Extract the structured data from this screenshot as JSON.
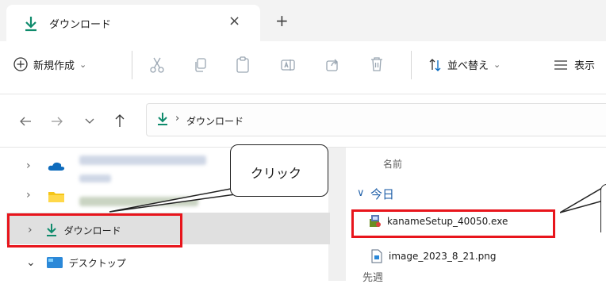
{
  "tab": {
    "title": "ダウンロード",
    "close_glyph": "×",
    "new_tab_glyph": "+"
  },
  "toolbar": {
    "new_label": "新規作成",
    "new_chevron": "⌄",
    "sort_label": "並べ替え",
    "sort_chevron": "⌄",
    "view_label": "表示"
  },
  "address": {
    "separator": "›",
    "path": "ダウンロード"
  },
  "sidebar": {
    "items": [
      {
        "expander": "›",
        "icon": "cloud-icon"
      },
      {
        "expander": "›",
        "icon": "folder-icon"
      },
      {
        "expander": "›",
        "label": "ダウンロード",
        "icon": "download-icon"
      },
      {
        "expander": "⌄",
        "label": "デスクトップ",
        "icon": "desktop-icon"
      }
    ]
  },
  "content": {
    "column_name": "名前",
    "group_today": "今日",
    "group_chevron": "∨",
    "files": [
      {
        "name": "kanameSetup_40050.exe",
        "icon": "installer-icon"
      },
      {
        "name": "image_2023_8_21.png",
        "icon": "image-file-icon"
      }
    ],
    "next_group_partial": "先週"
  },
  "callout": {
    "label": "クリック"
  },
  "colors": {
    "accent": "#0f8b6c",
    "highlight": "#e8151c",
    "selected_row": "#e0e0e0",
    "blue_icon": "#0067c0"
  }
}
